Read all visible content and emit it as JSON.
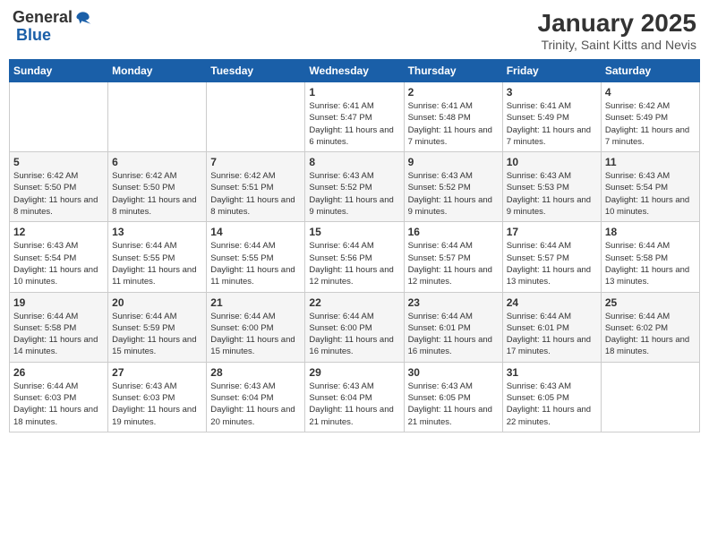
{
  "logo": {
    "general": "General",
    "blue": "Blue"
  },
  "header": {
    "month": "January 2025",
    "location": "Trinity, Saint Kitts and Nevis"
  },
  "weekdays": [
    "Sunday",
    "Monday",
    "Tuesday",
    "Wednesday",
    "Thursday",
    "Friday",
    "Saturday"
  ],
  "weeks": [
    [
      {
        "day": "",
        "info": ""
      },
      {
        "day": "",
        "info": ""
      },
      {
        "day": "",
        "info": ""
      },
      {
        "day": "1",
        "info": "Sunrise: 6:41 AM\nSunset: 5:47 PM\nDaylight: 11 hours and 6 minutes."
      },
      {
        "day": "2",
        "info": "Sunrise: 6:41 AM\nSunset: 5:48 PM\nDaylight: 11 hours and 7 minutes."
      },
      {
        "day": "3",
        "info": "Sunrise: 6:41 AM\nSunset: 5:49 PM\nDaylight: 11 hours and 7 minutes."
      },
      {
        "day": "4",
        "info": "Sunrise: 6:42 AM\nSunset: 5:49 PM\nDaylight: 11 hours and 7 minutes."
      }
    ],
    [
      {
        "day": "5",
        "info": "Sunrise: 6:42 AM\nSunset: 5:50 PM\nDaylight: 11 hours and 8 minutes."
      },
      {
        "day": "6",
        "info": "Sunrise: 6:42 AM\nSunset: 5:50 PM\nDaylight: 11 hours and 8 minutes."
      },
      {
        "day": "7",
        "info": "Sunrise: 6:42 AM\nSunset: 5:51 PM\nDaylight: 11 hours and 8 minutes."
      },
      {
        "day": "8",
        "info": "Sunrise: 6:43 AM\nSunset: 5:52 PM\nDaylight: 11 hours and 9 minutes."
      },
      {
        "day": "9",
        "info": "Sunrise: 6:43 AM\nSunset: 5:52 PM\nDaylight: 11 hours and 9 minutes."
      },
      {
        "day": "10",
        "info": "Sunrise: 6:43 AM\nSunset: 5:53 PM\nDaylight: 11 hours and 9 minutes."
      },
      {
        "day": "11",
        "info": "Sunrise: 6:43 AM\nSunset: 5:54 PM\nDaylight: 11 hours and 10 minutes."
      }
    ],
    [
      {
        "day": "12",
        "info": "Sunrise: 6:43 AM\nSunset: 5:54 PM\nDaylight: 11 hours and 10 minutes."
      },
      {
        "day": "13",
        "info": "Sunrise: 6:44 AM\nSunset: 5:55 PM\nDaylight: 11 hours and 11 minutes."
      },
      {
        "day": "14",
        "info": "Sunrise: 6:44 AM\nSunset: 5:55 PM\nDaylight: 11 hours and 11 minutes."
      },
      {
        "day": "15",
        "info": "Sunrise: 6:44 AM\nSunset: 5:56 PM\nDaylight: 11 hours and 12 minutes."
      },
      {
        "day": "16",
        "info": "Sunrise: 6:44 AM\nSunset: 5:57 PM\nDaylight: 11 hours and 12 minutes."
      },
      {
        "day": "17",
        "info": "Sunrise: 6:44 AM\nSunset: 5:57 PM\nDaylight: 11 hours and 13 minutes."
      },
      {
        "day": "18",
        "info": "Sunrise: 6:44 AM\nSunset: 5:58 PM\nDaylight: 11 hours and 13 minutes."
      }
    ],
    [
      {
        "day": "19",
        "info": "Sunrise: 6:44 AM\nSunset: 5:58 PM\nDaylight: 11 hours and 14 minutes."
      },
      {
        "day": "20",
        "info": "Sunrise: 6:44 AM\nSunset: 5:59 PM\nDaylight: 11 hours and 15 minutes."
      },
      {
        "day": "21",
        "info": "Sunrise: 6:44 AM\nSunset: 6:00 PM\nDaylight: 11 hours and 15 minutes."
      },
      {
        "day": "22",
        "info": "Sunrise: 6:44 AM\nSunset: 6:00 PM\nDaylight: 11 hours and 16 minutes."
      },
      {
        "day": "23",
        "info": "Sunrise: 6:44 AM\nSunset: 6:01 PM\nDaylight: 11 hours and 16 minutes."
      },
      {
        "day": "24",
        "info": "Sunrise: 6:44 AM\nSunset: 6:01 PM\nDaylight: 11 hours and 17 minutes."
      },
      {
        "day": "25",
        "info": "Sunrise: 6:44 AM\nSunset: 6:02 PM\nDaylight: 11 hours and 18 minutes."
      }
    ],
    [
      {
        "day": "26",
        "info": "Sunrise: 6:44 AM\nSunset: 6:03 PM\nDaylight: 11 hours and 18 minutes."
      },
      {
        "day": "27",
        "info": "Sunrise: 6:43 AM\nSunset: 6:03 PM\nDaylight: 11 hours and 19 minutes."
      },
      {
        "day": "28",
        "info": "Sunrise: 6:43 AM\nSunset: 6:04 PM\nDaylight: 11 hours and 20 minutes."
      },
      {
        "day": "29",
        "info": "Sunrise: 6:43 AM\nSunset: 6:04 PM\nDaylight: 11 hours and 21 minutes."
      },
      {
        "day": "30",
        "info": "Sunrise: 6:43 AM\nSunset: 6:05 PM\nDaylight: 11 hours and 21 minutes."
      },
      {
        "day": "31",
        "info": "Sunrise: 6:43 AM\nSunset: 6:05 PM\nDaylight: 11 hours and 22 minutes."
      },
      {
        "day": "",
        "info": ""
      }
    ]
  ]
}
